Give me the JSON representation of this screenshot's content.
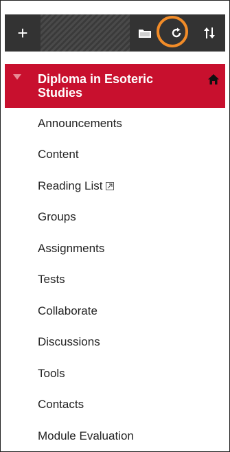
{
  "toolbar": {
    "add_icon": "plus-icon",
    "folder_icon": "folder-icon",
    "refresh_icon": "refresh-icon",
    "sort_icon": "sort-arrows-icon",
    "add_glyph": "+"
  },
  "course": {
    "title": "Diploma in Esoteric Studies",
    "home_icon": "home-icon",
    "color": "#c8102e"
  },
  "menu": {
    "items": [
      {
        "label": "Announcements"
      },
      {
        "label": "Content"
      },
      {
        "label": "Reading List",
        "external": true
      },
      {
        "label": "Groups"
      },
      {
        "label": "Assignments"
      },
      {
        "label": "Tests"
      },
      {
        "label": "Collaborate"
      },
      {
        "label": "Discussions"
      },
      {
        "label": "Tools"
      },
      {
        "label": "Contacts"
      },
      {
        "label": "Module Evaluation"
      }
    ]
  },
  "colors": {
    "toolbar_bg": "#333333",
    "highlight_ring": "#f28c28"
  }
}
